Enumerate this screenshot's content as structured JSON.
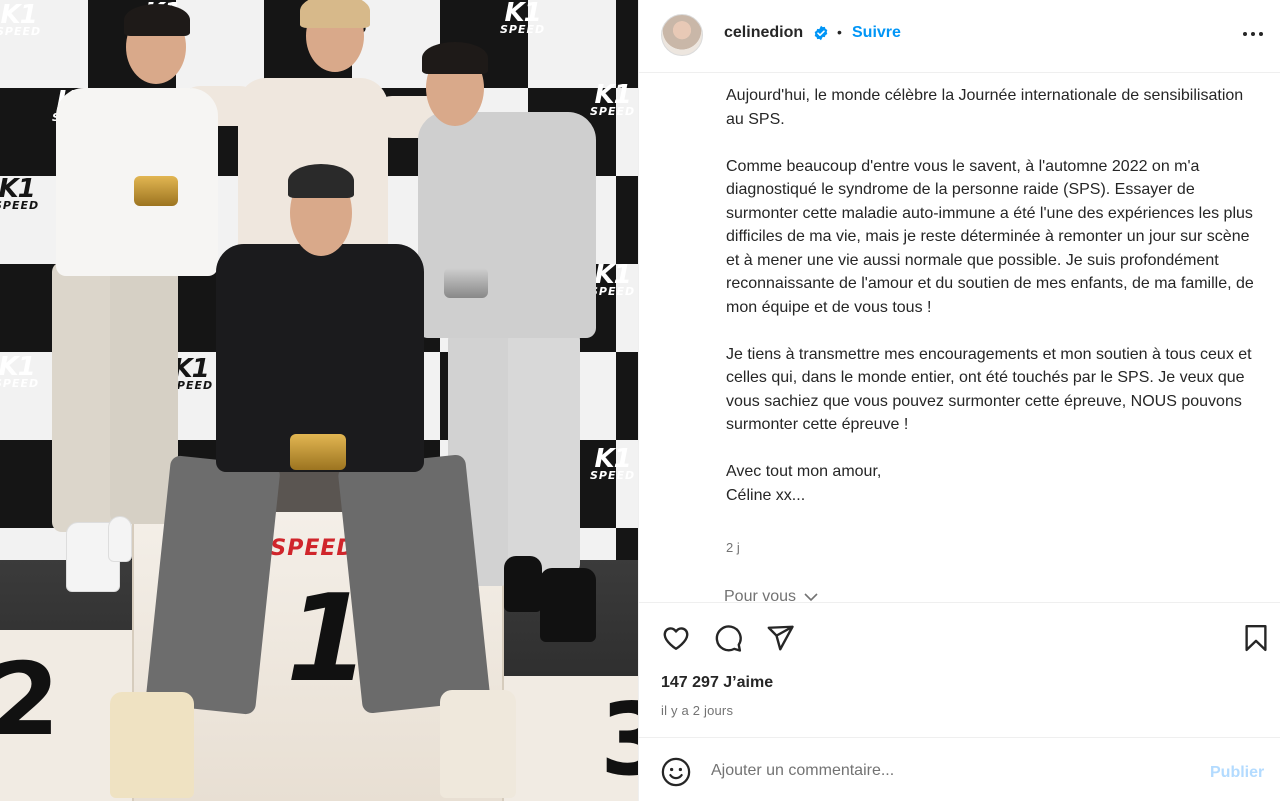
{
  "photo": {
    "logo_brand": "K1",
    "logo_sub": "SPEED",
    "podium_brand": "K1SPEED",
    "podium_number": "1",
    "podium_number_left": "2",
    "podium_number_right": "3"
  },
  "header": {
    "username": "celinedion",
    "separator": "•",
    "follow_label": "Suivre"
  },
  "caption": {
    "paragraphs": [
      "Aujourd'hui, le monde célèbre la Journée internationale de sensibilisation au SPS.",
      "Comme beaucoup d'entre vous le savent, à l'automne 2022 on m'a diagnostiqué le syndrome de la personne raide (SPS). Essayer de surmonter cette maladie auto-immune a été l'une des expériences les plus difficiles de ma vie, mais je reste déterminée à remonter un jour sur scène et à mener une vie aussi normale que possible. Je suis profondément reconnaissante de l'amour et du soutien de mes enfants, de ma famille, de mon équipe et de vous tous !",
      "Je tiens à transmettre mes encouragements et mon soutien à tous ceux et celles qui, dans le monde entier, ont été touchés par le SPS. Je veux que vous sachiez que vous pouvez surmonter cette épreuve, NOUS pouvons surmonter cette épreuve !"
    ],
    "signoff_line1": "Avec tout mon amour,",
    "signoff_line2": "Céline xx...",
    "time": "2 j",
    "for_you": "Pour vous"
  },
  "stats": {
    "likes": "147 297 J’aime",
    "posted_ago": "il y a 2 jours"
  },
  "comment": {
    "placeholder": "Ajouter un commentaire...",
    "publish_label": "Publier"
  },
  "colors": {
    "accent": "#0095f6",
    "publish_disabled": "#b3dbff",
    "text": "#262626",
    "muted": "#737373",
    "border": "#efefef"
  },
  "icons": [
    "verified-badge-icon",
    "more-options-icon",
    "heart-icon",
    "comment-icon",
    "share-icon",
    "bookmark-icon",
    "emoji-icon",
    "chevron-down-icon"
  ]
}
